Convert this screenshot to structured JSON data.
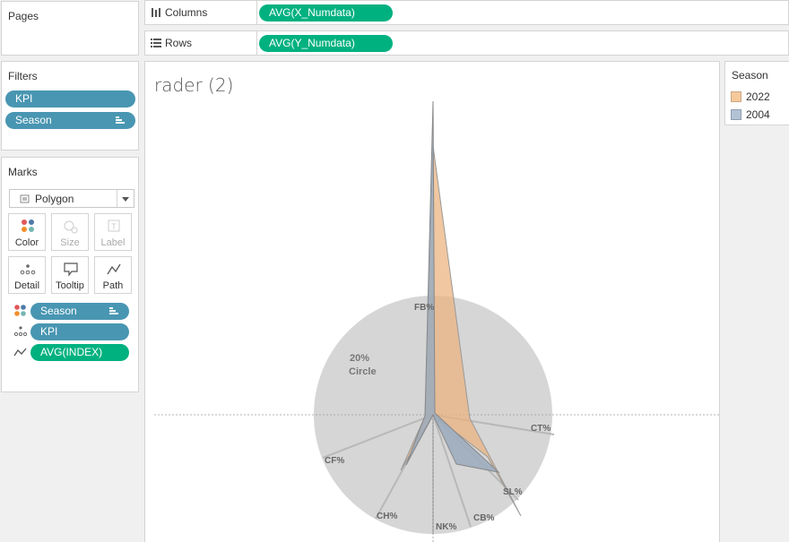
{
  "pages": {
    "title": "Pages"
  },
  "columns": {
    "label": "Columns",
    "pill": "AVG(X_Numdata)"
  },
  "rows": {
    "label": "Rows",
    "pill": "AVG(Y_Numdata)"
  },
  "filters": {
    "title": "Filters",
    "pills": [
      "KPI",
      "Season"
    ]
  },
  "marks": {
    "title": "Marks",
    "type": "Polygon",
    "buttons": [
      "Color",
      "Size",
      "Label",
      "Detail",
      "Tooltip",
      "Path"
    ],
    "fields": [
      "Season",
      "KPI",
      "AVG(INDEX)"
    ]
  },
  "legend": {
    "title": "Season",
    "items": [
      {
        "label": "2022",
        "color": "#f5c99a"
      },
      {
        "label": "2004",
        "color": "#b4c3d4"
      }
    ]
  },
  "worksheet": {
    "title": "rader (2)"
  },
  "chart_data": {
    "type": "radar",
    "circle_label": [
      "20%",
      "Circle"
    ],
    "axes": [
      "FB%",
      "CT%",
      "SL%",
      "CB%",
      "NK%",
      "CH%",
      "CF%"
    ],
    "series": [
      {
        "name": "2022",
        "color": "#eab27d"
      },
      {
        "name": "2004",
        "color": "#9aaabd"
      }
    ]
  }
}
